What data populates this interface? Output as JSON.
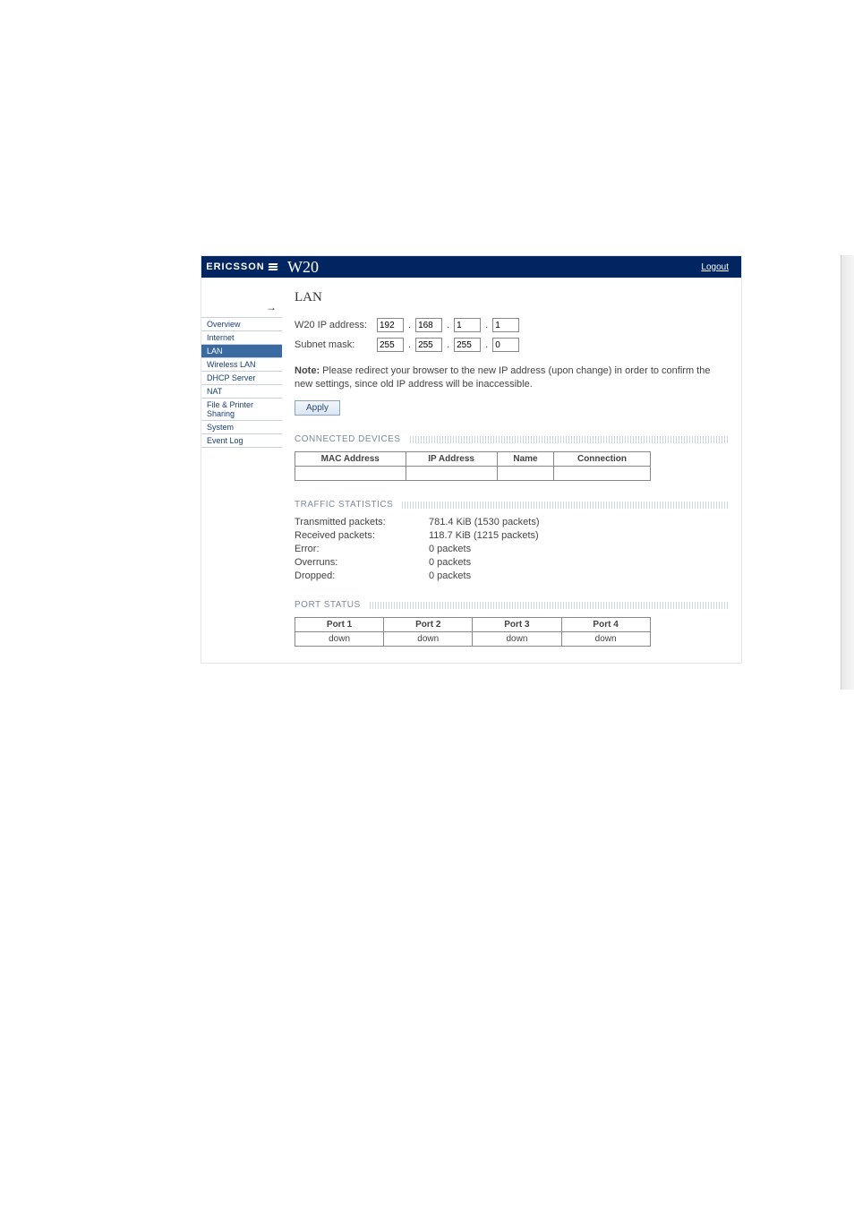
{
  "brand": "ERICSSON",
  "product": "W20",
  "logout": "Logout",
  "nav": {
    "collapse": "→",
    "items": [
      {
        "label": "Overview"
      },
      {
        "label": "Internet"
      },
      {
        "label": "LAN"
      },
      {
        "label": "Wireless LAN"
      },
      {
        "label": "DHCP Server"
      },
      {
        "label": "NAT"
      },
      {
        "label": "File & Printer Sharing"
      },
      {
        "label": "System"
      },
      {
        "label": "Event Log"
      }
    ],
    "active_index": 2
  },
  "page": {
    "title": "LAN",
    "ip_label": "W20 IP address:",
    "subnet_label": "Subnet mask:",
    "ip": [
      "192",
      "168",
      "1",
      "1"
    ],
    "mask": [
      "255",
      "255",
      "255",
      "0"
    ],
    "note_bold": "Note:",
    "note_text": " Please redirect your browser to the new IP address (upon change) in order to confirm the new settings, since old IP address will be inaccessible.",
    "apply": "Apply"
  },
  "connected": {
    "heading": "CONNECTED DEVICES",
    "cols": [
      "MAC Address",
      "IP Address",
      "Name",
      "Connection"
    ]
  },
  "traffic": {
    "heading": "TRAFFIC STATISTICS",
    "rows": [
      {
        "label": "Transmitted packets:",
        "value": "781.4 KiB (1530 packets)"
      },
      {
        "label": "Received packets:",
        "value": "118.7 KiB (1215 packets)"
      },
      {
        "label": "Error:",
        "value": "0 packets"
      },
      {
        "label": "Overruns:",
        "value": "0 packets"
      },
      {
        "label": "Dropped:",
        "value": "0 packets"
      }
    ]
  },
  "ports": {
    "heading": "PORT STATUS",
    "cols": [
      "Port 1",
      "Port 2",
      "Port 3",
      "Port 4"
    ],
    "vals": [
      "down",
      "down",
      "down",
      "down"
    ]
  }
}
